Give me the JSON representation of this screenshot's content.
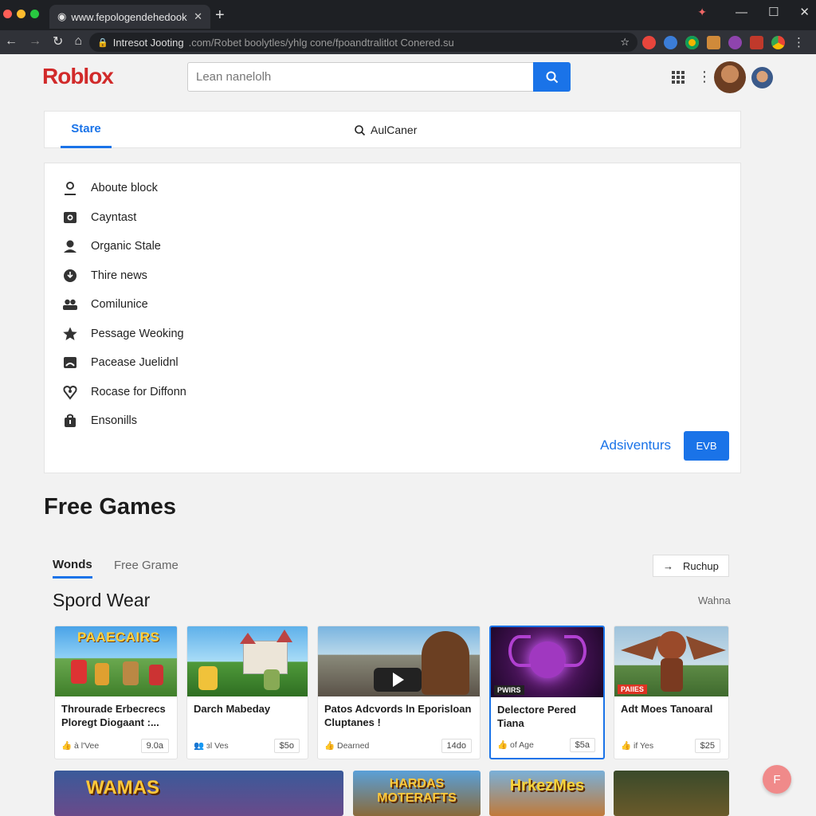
{
  "browser": {
    "tab_title": "www.fepologendehedook",
    "url_main": "Intresot Jooting",
    "url_rest": ".com/Robet boolytles/yhlg cone/fpoandtralitlot Conered.su"
  },
  "header": {
    "logo": "Roblox",
    "search_placeholder": "Lean nanelolh"
  },
  "store_tabs": {
    "active": "Stare",
    "other": "AulCaner"
  },
  "menu": {
    "items": [
      {
        "label": "Aboute block",
        "icon": "user-icon"
      },
      {
        "label": "Cayntast",
        "icon": "image-icon"
      },
      {
        "label": "Organic Stale",
        "icon": "person-icon"
      },
      {
        "label": "Thire news",
        "icon": "globe-icon"
      },
      {
        "label": "Comilunice",
        "icon": "group-icon"
      },
      {
        "label": "Pessage Weoking",
        "icon": "star-icon"
      },
      {
        "label": "Pacease Juelidnl",
        "icon": "folder-icon"
      },
      {
        "label": "Rocase for Diffonn",
        "icon": "heart-icon"
      },
      {
        "label": "Ensonills",
        "icon": "bag-icon"
      }
    ],
    "adv_link": "Adsiventurs",
    "adv_button": "EVB"
  },
  "free_games": {
    "title": "Free Games",
    "tab_active": "Wonds",
    "tab_other": "Free Grame",
    "rundup_label": "Ruchup",
    "section_title": "Spord Wear",
    "section_more": "Wahna",
    "cards": [
      {
        "thumb_text": "PAAECAIRS",
        "title": "Throurade Erbecrecs Ploregt Diogaant :...",
        "meta": "à l'Vee",
        "price": "9.0a"
      },
      {
        "title": "Darch Mabeday",
        "meta": "ɜl Ves",
        "price": "$5o"
      },
      {
        "title": "Patos Adcvords ln Eporisloan Cluptanes !",
        "meta": "Dearned",
        "price": "14do"
      },
      {
        "badge": "PWIRS",
        "title": "Delectore Pered Tiana",
        "meta": "of Age",
        "price": "$5a"
      },
      {
        "badge": "PAIIES",
        "title": "Adt Moes Tanoaral",
        "meta": "if Yes",
        "price": "$25"
      }
    ],
    "row2": [
      "WAMAS",
      "HARDAS MOTERAFTS",
      "HrkezMes",
      ""
    ]
  },
  "fab_label": "F",
  "colors": {
    "accent": "#1a73e8",
    "logo": "#d12a2a",
    "chrome_bg": "#1e2024",
    "page_bg": "#f2f2f2"
  }
}
